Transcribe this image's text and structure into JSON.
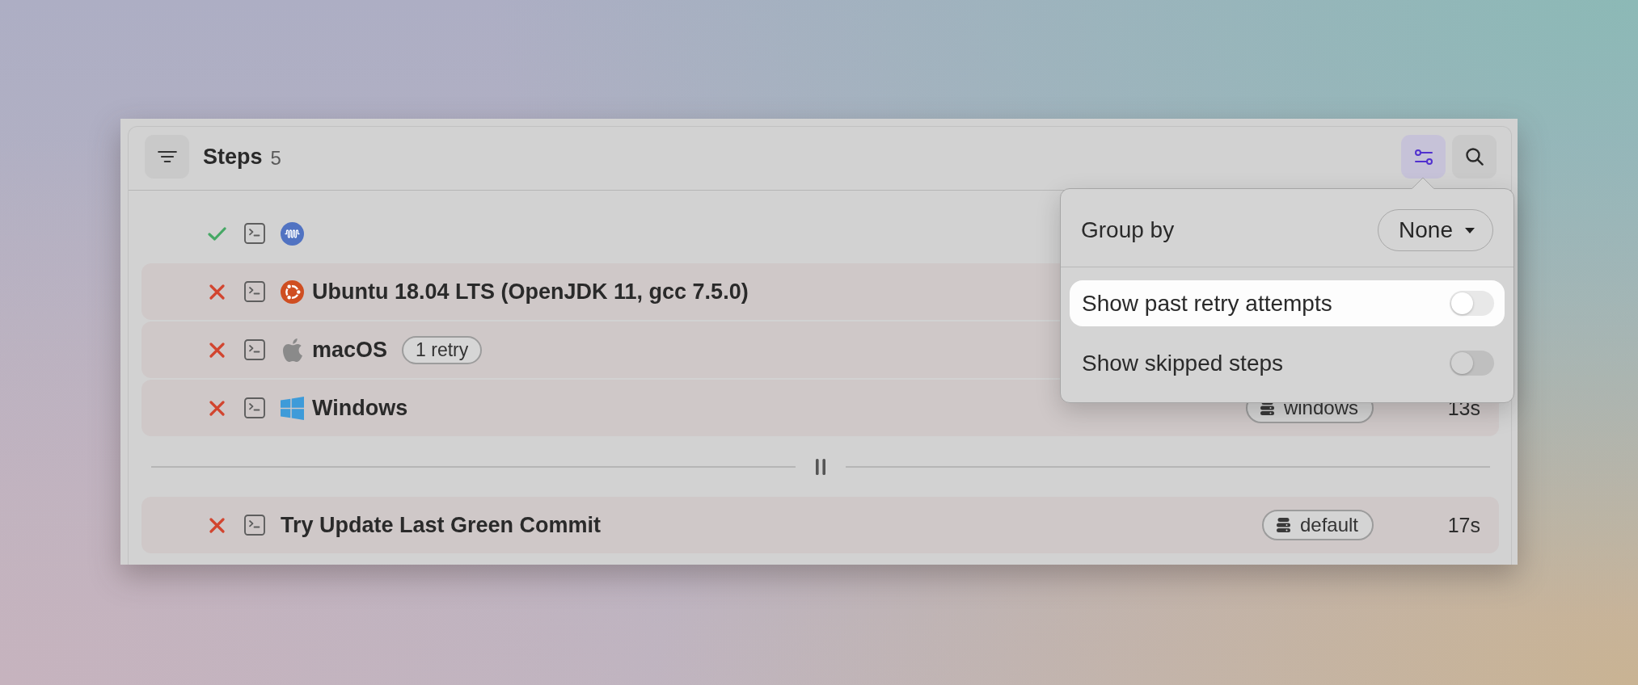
{
  "header": {
    "title": "Steps",
    "count": "5",
    "settings_pressed": true
  },
  "steps": [
    {
      "kind": "step",
      "failed": false,
      "logo": {
        "kind": "wave"
      }
    },
    {
      "kind": "step",
      "failed": true,
      "logo": {
        "kind": "ring"
      },
      "name": "Ubuntu 18.04 LTS (OpenJDK 11, gcc 7.5.0)"
    },
    {
      "kind": "step",
      "failed": true,
      "logo": {
        "kind": "apple"
      },
      "name": "macOS",
      "badge": "1 retry"
    },
    {
      "kind": "step",
      "failed": true,
      "logo": {
        "kind": "panes"
      },
      "name": "Windows",
      "agent": "windows",
      "duration": "13s"
    },
    {
      "kind": "wait"
    },
    {
      "kind": "step",
      "failed": true,
      "name": "Try Update Last Green Commit",
      "agent": "default",
      "duration": "17s"
    }
  ],
  "options": {
    "group_by_label": "Group by",
    "group_by_value": "None",
    "toggles": [
      {
        "label": "Show past retry attempts",
        "on": false,
        "highlighted": true
      },
      {
        "label": "Show skipped steps",
        "on": false,
        "highlighted": false
      }
    ]
  }
}
